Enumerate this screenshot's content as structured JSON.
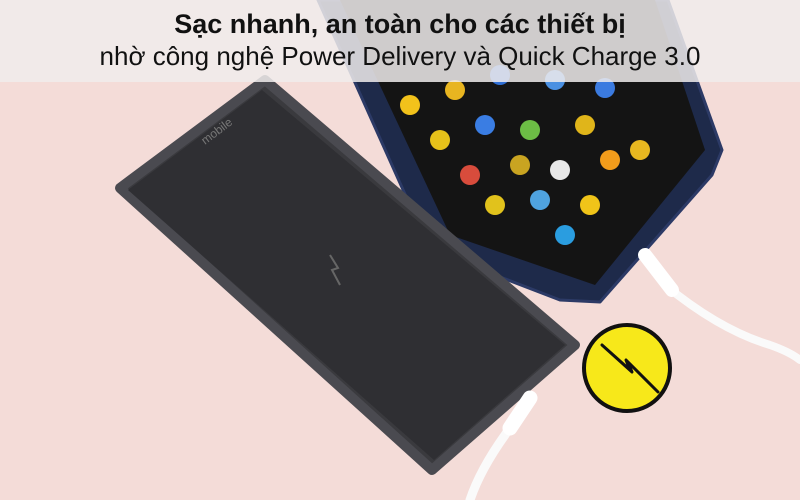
{
  "banner": {
    "title": "Sạc nhanh, an toàn cho các thiết bị",
    "subtitle": "nhờ công nghệ Power Delivery và Quick Charge 3.0"
  },
  "colors": {
    "background": "#f4dcd8",
    "power_bank": "#3a3a3e",
    "phone_frame": "#1e2a4a",
    "badge": "#f7e81a"
  },
  "icons": [
    "lightning-bolt-icon"
  ]
}
